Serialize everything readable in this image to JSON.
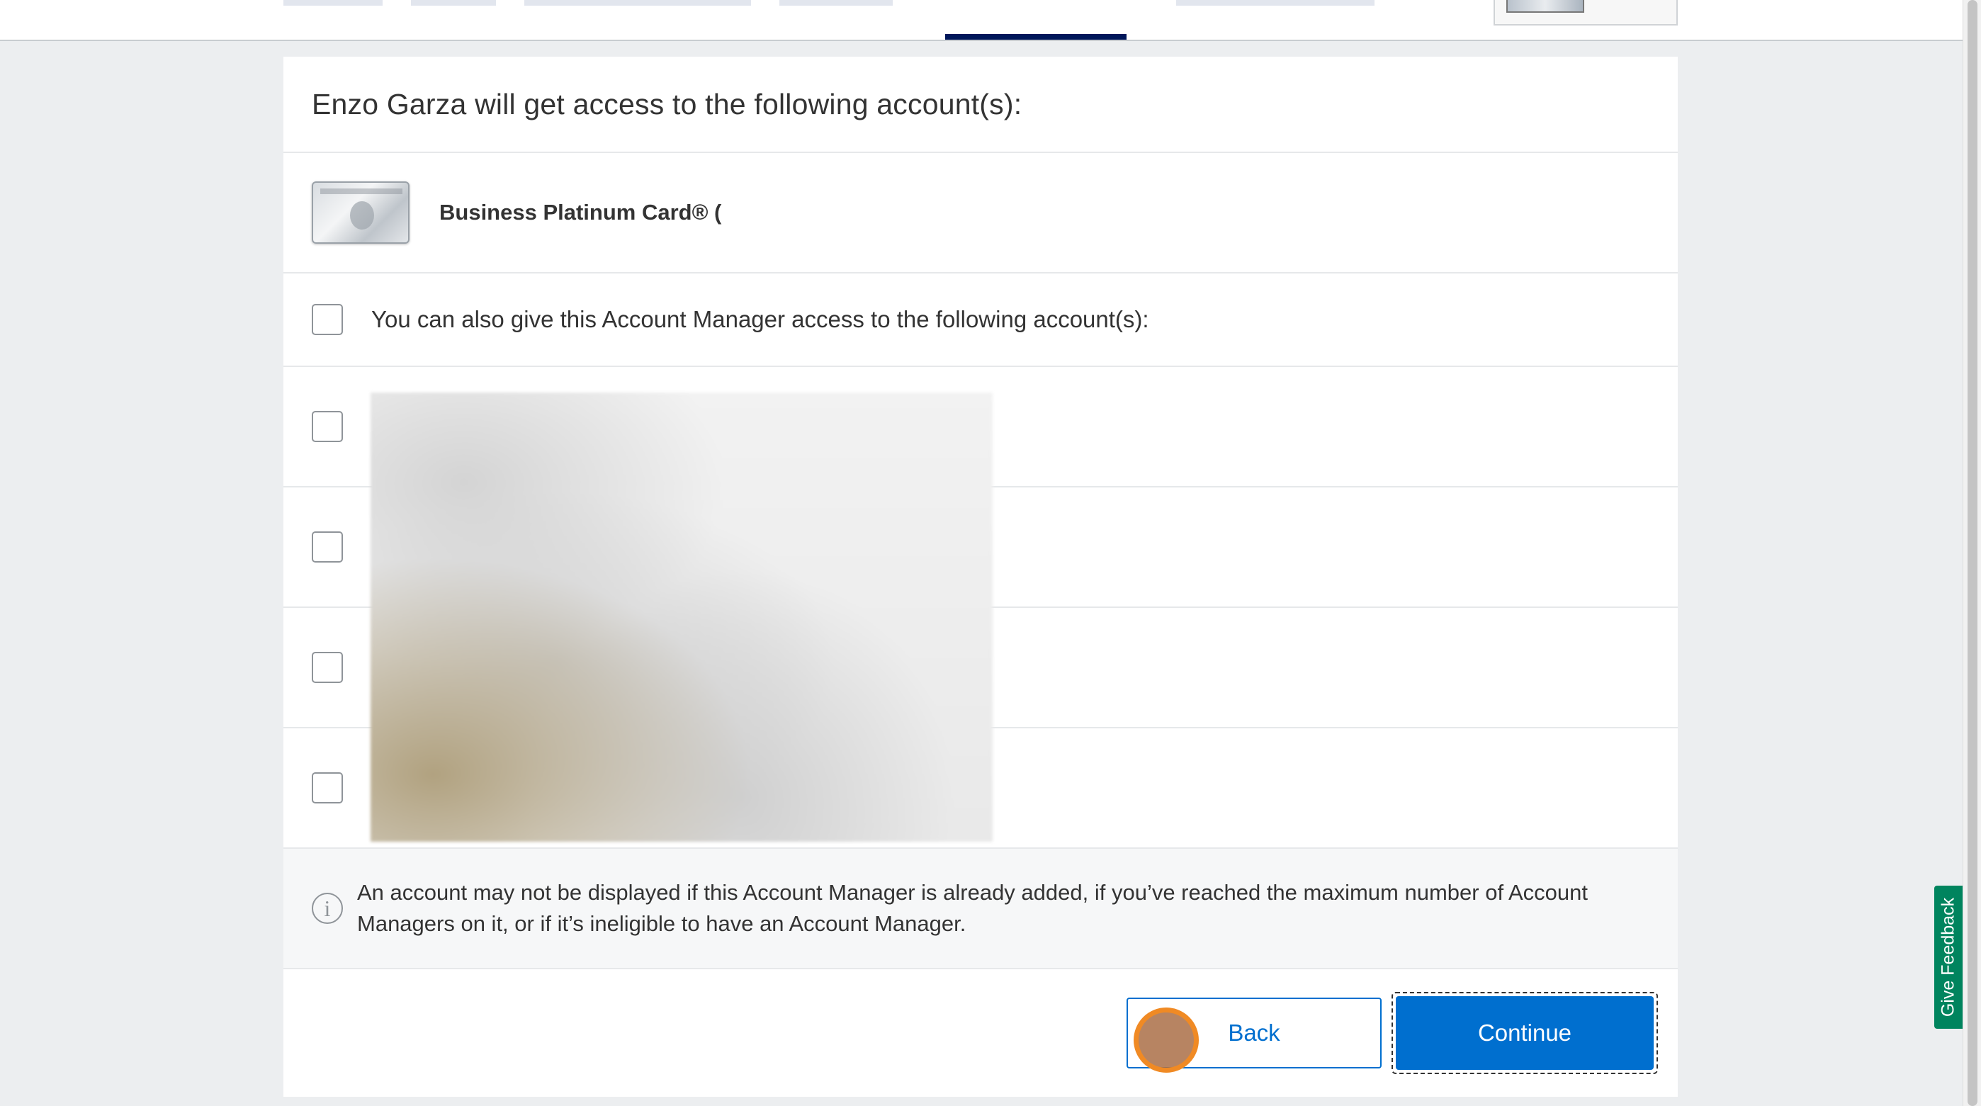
{
  "heading": "Enzo Garza will get access to the following account(s):",
  "card": {
    "name": "Business Platinum Card® ("
  },
  "also_give_label": "You can also give this Account Manager access to the following account(s):",
  "account_rows": [
    {
      "checked": false
    },
    {
      "checked": false
    },
    {
      "checked": false
    },
    {
      "checked": false
    }
  ],
  "info_text": "An account may not be displayed if this Account Manager is already added, if you’ve reached the maximum number of Account Managers on it, or if it’s ineligible to have an Account Manager.",
  "buttons": {
    "back": "Back",
    "continue": "Continue"
  },
  "feedback_label": "Give Feedback",
  "colors": {
    "primary_blue": "#006fcf",
    "nav_indicator": "#00175a",
    "feedback_green": "#00845e"
  }
}
